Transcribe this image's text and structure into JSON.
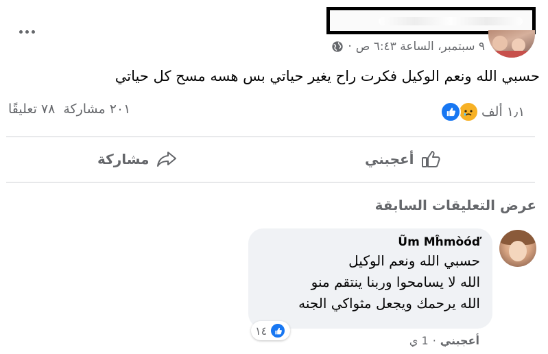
{
  "post": {
    "meta": {
      "date_time": "٩ سبتمبر، الساعة ٦:٤٣ ص",
      "separator": "·",
      "globe_icon": "globe-icon"
    },
    "text": "حسبي الله ونعم الوكيل فكرت راح يغير حياتي بس هسه مسح كل حياتي",
    "reactions": {
      "count": "١٫١ ألف",
      "icons": [
        "like-icon",
        "sad-icon"
      ]
    },
    "comments_count": "٧٨ تعليقًا",
    "shares_count": "٢٠١ مشاركة"
  },
  "actions": {
    "like_label": "أعجبني",
    "share_label": "مشاركة"
  },
  "view_previous_comments": "عرض التعليقات السابقة",
  "comment": {
    "author": "Ũm Mĥmòóď",
    "lines": [
      "حسبي الله ونعم الوكيل",
      "الله لا يسامحوا وربنا ينتقم منو",
      "الله يرحمك ويجعل مثواكي الجنه"
    ],
    "reaction_count": "١٤",
    "like_label": "أعجبني",
    "separator": "·",
    "time": "1 ي"
  },
  "colors": {
    "accent": "#1877f2",
    "secondary_text": "#65676b",
    "bubble_bg": "#f0f2f5",
    "sad_yellow": "#f7b125"
  }
}
